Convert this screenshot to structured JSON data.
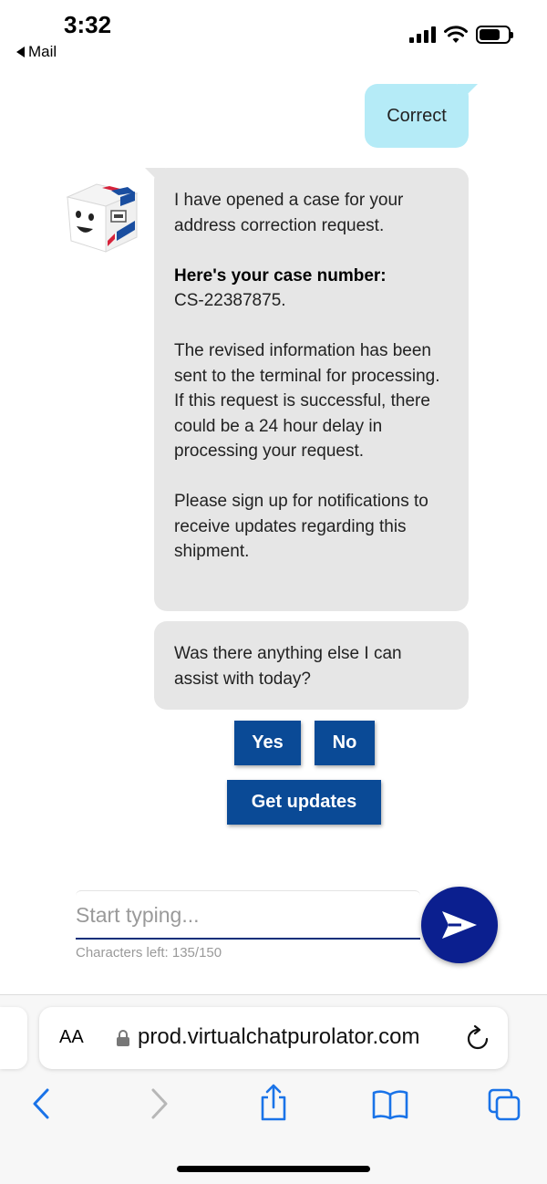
{
  "status_bar": {
    "time": "3:32",
    "back_app": "Mail"
  },
  "chat": {
    "user_message": "Correct",
    "bot_message_1": {
      "p1": "I have opened a case for your address correction request.",
      "case_label": "Here's your case number:",
      "case_number": "CS-22387875.",
      "p3": "The revised information has been sent to the terminal for processing. If this request is successful, there could be a 24 hour delay in processing your request.",
      "p4": "Please sign up for notifications to receive updates regarding this shipment."
    },
    "bot_message_2": "Was there anything else I can assist with today?",
    "quick_replies": {
      "yes": "Yes",
      "no": "No",
      "get_updates": "Get updates"
    }
  },
  "composer": {
    "placeholder": "Start typing...",
    "value": "",
    "char_count": "Characters left: 135/150"
  },
  "browser": {
    "text_size_label": "AA",
    "url": "prod.virtualchatpurolator.com"
  },
  "colors": {
    "brand_blue": "#0a4a96",
    "send_button": "#0b1f8f",
    "user_bubble": "#b5ebf7",
    "bot_bubble": "#e6e6e6",
    "ios_blue": "#1a73e8"
  }
}
